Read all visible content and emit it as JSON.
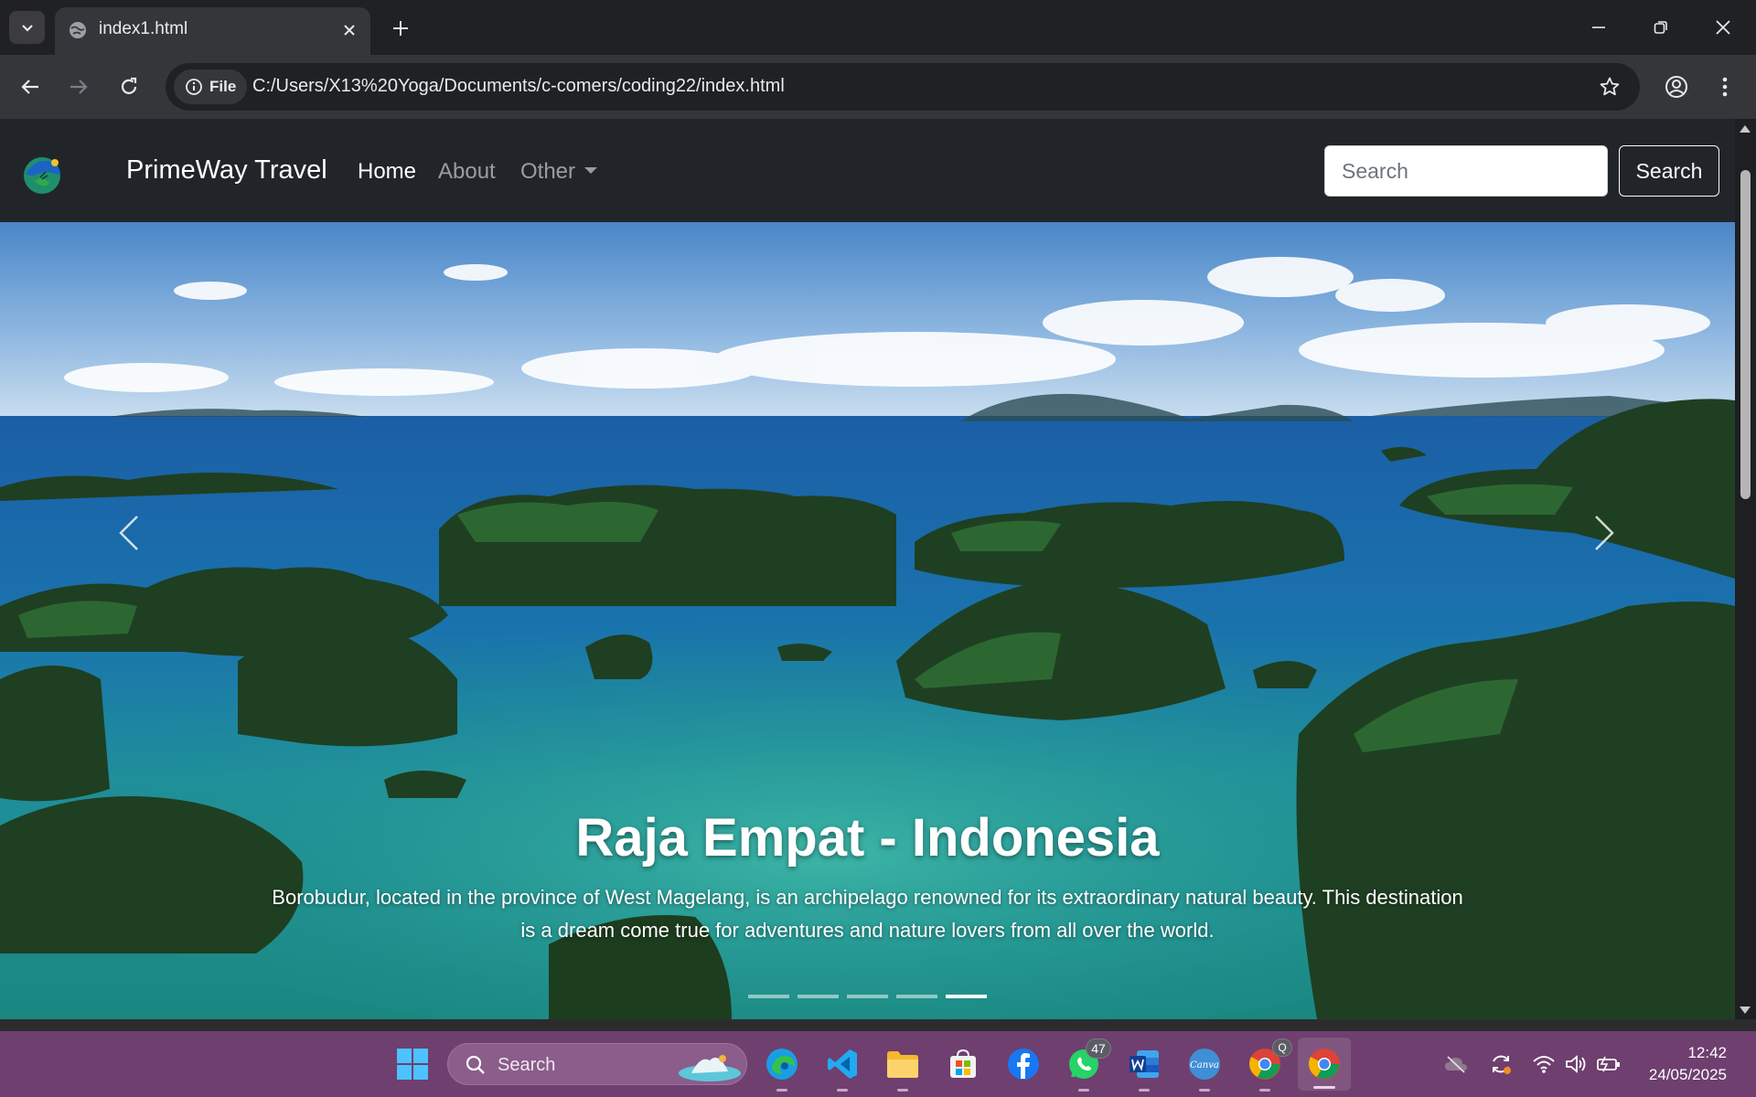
{
  "browser": {
    "tab_title": "index1.html",
    "url_chip": "File",
    "url": "C:/Users/X13%20Yoga/Documents/c-comers/coding22/index.html"
  },
  "site": {
    "brand": "PrimeWay Travel",
    "nav": [
      {
        "label": "Home",
        "active": true
      },
      {
        "label": "About",
        "active": false
      },
      {
        "label": "Other",
        "active": false,
        "dropdown": true
      }
    ],
    "search_placeholder": "Search",
    "search_button": "Search"
  },
  "carousel": {
    "title": "Raja Empat - Indonesia",
    "text": "Borobudur, located in the province of West Magelang, is an archipelago renowned for its extraordinary natural beauty. This destination is a dream come true for adventures and nature lovers from all over the world.",
    "slide_count": 5,
    "active_slide": 5
  },
  "taskbar": {
    "search_label": "Search",
    "whatsapp_badge": "47",
    "chrome_profile_badge": "Q",
    "time": "12:42",
    "date": "24/05/2025"
  },
  "colors": {
    "page_bg": "#212529",
    "taskbar": "#6f3f6f",
    "browser_chrome": "#35363a"
  }
}
